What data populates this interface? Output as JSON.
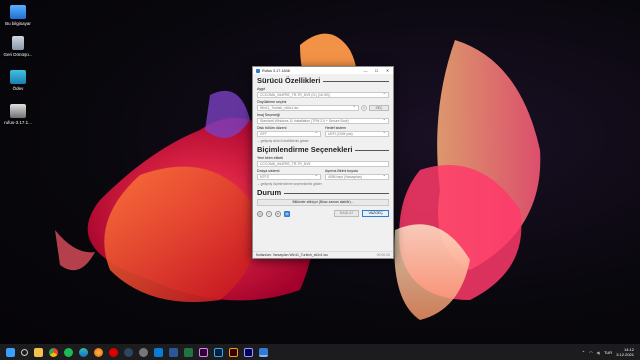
{
  "desktop": {
    "icons": [
      {
        "label": "Bu bilgisayar",
        "icon": "monitor-icon"
      },
      {
        "label": "Geri Dönüşü...",
        "icon": "recycle-bin-icon"
      },
      {
        "label": "Ödev",
        "icon": "folder-icon"
      },
      {
        "label": "rufus-3.17.1...",
        "icon": "usb-drive-icon"
      }
    ]
  },
  "window": {
    "title": "Rufus 3.17.1846",
    "buttons": {
      "minimize": "—",
      "maximize": "☐",
      "close": "✕"
    },
    "drive_section": {
      "heading": "Sürücü Özellikleri",
      "device_label": "Aygıt",
      "device_value": "CCCOMA_X64FRE_TR-TR_DV9 (G:) [16 GB]",
      "boot_label": "Önyükleme seçimi",
      "boot_value": "Win11_Turkish_x64v1.iso",
      "select_button": "SEÇ",
      "image_label": "İmaj Seçeneği",
      "image_value": "Standard Windows 11 Installation (TPM 2.0 + Secure Boot)",
      "partition_label": "Disk bölüm düzeni",
      "partition_value": "GPT",
      "target_label": "Hedef sistem",
      "target_value": "UEFI (CSM yok)",
      "advanced_toggle": "gelişmiş sürücü özelliklerini göster"
    },
    "format_section": {
      "heading": "Biçimlendirme Seçenekleri",
      "volume_label": "Yeni birim etiketi",
      "volume_value": "CCCOMA_X64FRE_TR-TR_DV9",
      "fs_label": "Dosya sistemi",
      "fs_value": "NTFS",
      "cluster_label": "Ayırma Birimi boyutu",
      "cluster_value": "4096 bayt (Varsayılan)",
      "advanced_toggle": "gelişmiş biçimlendirme seçeneklerini göster"
    },
    "status_section": {
      "heading": "Durum",
      "status_text": "Bitlümler siliniyor (Biraz zaman alabilir)..."
    },
    "actions": {
      "start": "BAŞLAT",
      "cancel": "VAZGEÇ"
    },
    "footer": {
      "text": "Kullanılan: Varsayılan Win11_Turkish_x64v1.iso",
      "time": "00:00:25"
    }
  },
  "taskbar": {
    "apps": [
      "start-icon",
      "search-icon",
      "explorer-icon",
      "chrome-icon",
      "spotify-icon",
      "edge-icon",
      "firefox-icon",
      "opera-icon",
      "steam-icon",
      "settings-icon",
      "store-icon",
      "word-icon",
      "excel-icon",
      "premiere-icon",
      "photoshop-icon",
      "illustrator-icon",
      "aftereffects-icon",
      "rufus-icon"
    ],
    "tray": {
      "lang": "TUR",
      "time": "14:12",
      "date": "3.12.2021"
    }
  },
  "colors": {
    "accent": "#2f7bd8",
    "taskbar": "#1c1c1f"
  }
}
